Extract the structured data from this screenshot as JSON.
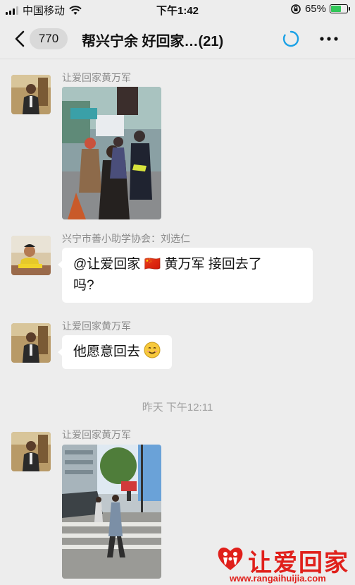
{
  "status_bar": {
    "carrier": "中国移动",
    "time": "下午1:42",
    "battery_percent": "65%",
    "battery_level": 0.65
  },
  "nav": {
    "unread_count": "770",
    "title": "帮兴宁余  好回家…(21)"
  },
  "messages": [
    {
      "sender": "让爱回家黄万军",
      "type": "image"
    },
    {
      "sender": "兴宁市善小助学协会：刘选仁",
      "type": "text",
      "text_line1": "@让爱回家 🇨🇳 黄万军 接回去了",
      "text_line2": "吗?"
    },
    {
      "sender": "让爱回家黄万军",
      "type": "text",
      "text": "他愿意回去"
    },
    {
      "sender": "让爱回家黄万军",
      "type": "image"
    }
  ],
  "time_separator": "昨天 下午12:11",
  "watermark": {
    "text": "让爱回家",
    "url": "www.rangaihuijia.com"
  },
  "colors": {
    "background": "#ededed",
    "bubble": "#ffffff",
    "accent_blue": "#1aa1e6",
    "watermark_red": "#e0201b"
  }
}
